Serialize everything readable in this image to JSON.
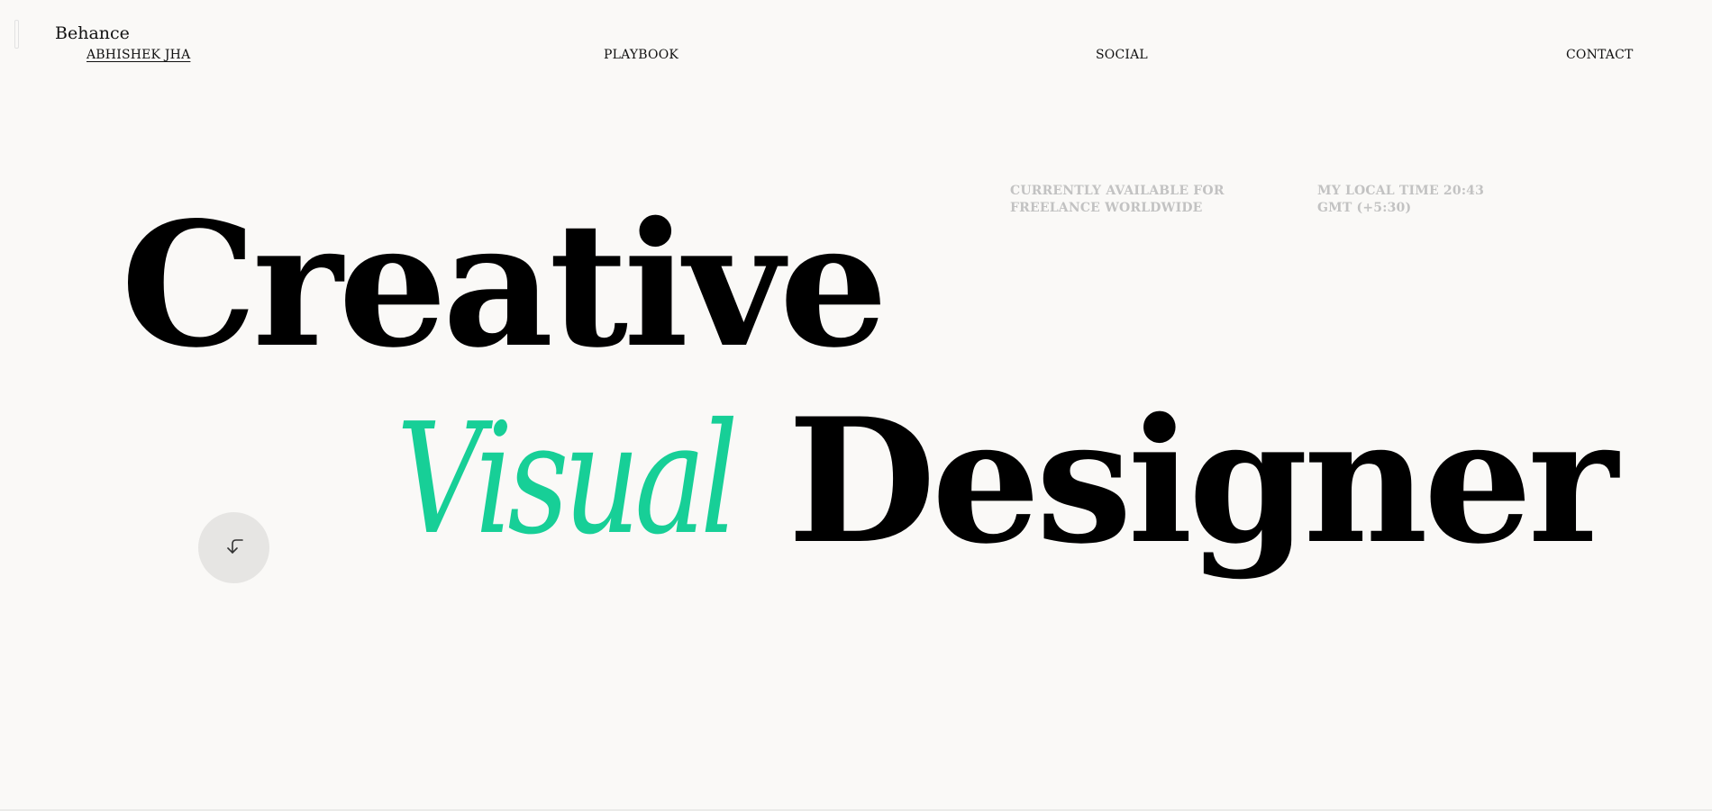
{
  "brand": {
    "name": "Behance"
  },
  "nav": {
    "items": [
      {
        "label": "ABHISHEK JHA",
        "active": true
      },
      {
        "label": "PLAYBOOK",
        "active": false
      },
      {
        "label": "SOCIAL",
        "active": false
      },
      {
        "label": "CONTACT",
        "active": false
      }
    ]
  },
  "meta": {
    "availability_line1": "CURRENTLY AVAILABLE FOR",
    "availability_line2": "FREELANCE WORLDWIDE",
    "time_line1": "MY LOCAL TIME 20:43",
    "time_line2": "GMT (+5:30)"
  },
  "hero": {
    "line1": "Creative",
    "accent": "Visual",
    "line2": "Designer"
  },
  "scroll_button": {
    "icon": "arrow-down-left-icon"
  },
  "colors": {
    "background": "#faf9f7",
    "accent": "#17cf97",
    "text": "#000000",
    "muted": "#c2c2c2",
    "button_bg": "#e6e5e3"
  }
}
